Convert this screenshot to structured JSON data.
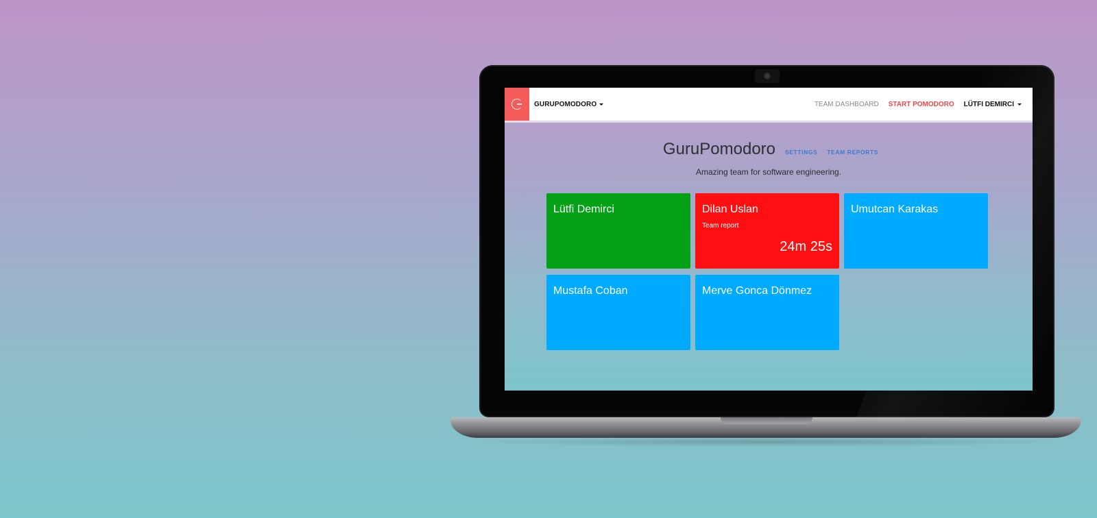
{
  "navbar": {
    "brand": "GURUPOMODORO",
    "links": {
      "team_dashboard": "TEAM DASHBOARD",
      "start_pomodoro": "START POMODORO",
      "user": "LÜTFI DEMIRCI"
    }
  },
  "team": {
    "name": "GuruPomodoro",
    "settings_link": "SETTINGS",
    "reports_link": "TEAM REPORTS",
    "description": "Amazing team for software engineering."
  },
  "members": [
    {
      "name": "Lütfi Demirci",
      "status": "",
      "timer": "",
      "color": "#04a016"
    },
    {
      "name": "Dilan Uslan",
      "status": "Team report",
      "timer": "24m 25s",
      "color": "#ff0f12"
    },
    {
      "name": "Umutcan Karakas",
      "status": "",
      "timer": "",
      "color": "#00aaff"
    },
    {
      "name": "Mustafa Coban",
      "status": "",
      "timer": "",
      "color": "#00aaff"
    },
    {
      "name": "Merve Gonca Dönmez",
      "status": "",
      "timer": "",
      "color": "#00aaff"
    }
  ],
  "icons": {
    "logo": "g-logo-icon",
    "dropdown": "caret-down-icon"
  }
}
